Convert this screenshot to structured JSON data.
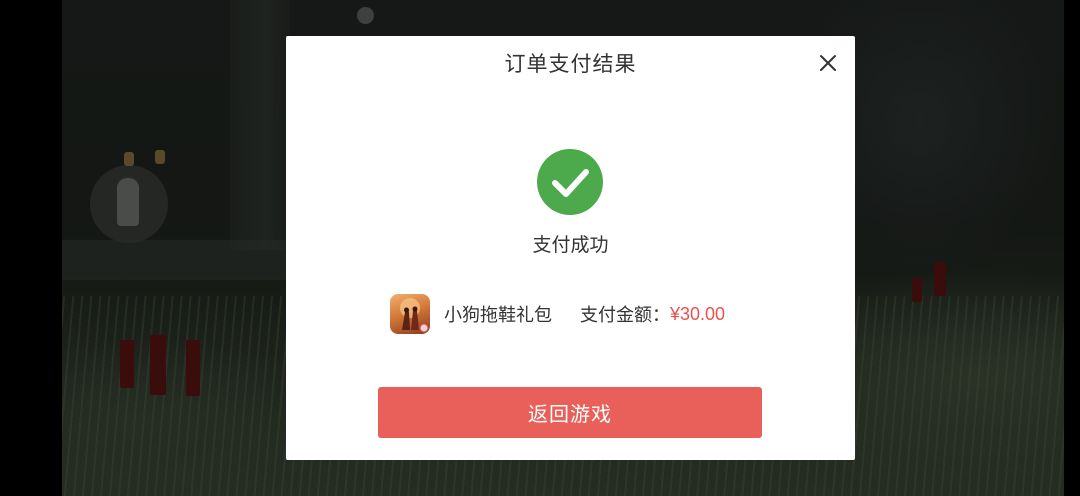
{
  "dialog": {
    "title": "订单支付结果",
    "close_icon": "close-icon",
    "status_icon": "checkmark-circle-icon",
    "status_text": "支付成功",
    "product_icon": "game-artwork-icon",
    "product_name": "小狗拖鞋礼包",
    "amount_label": "支付金额：",
    "amount_value": "¥30.00",
    "return_button_label": "返回游戏"
  },
  "colors": {
    "success_green": "#4caa4c",
    "accent_red": "#e9605a",
    "amount_red": "#e8534e",
    "text_dark": "#333333"
  }
}
